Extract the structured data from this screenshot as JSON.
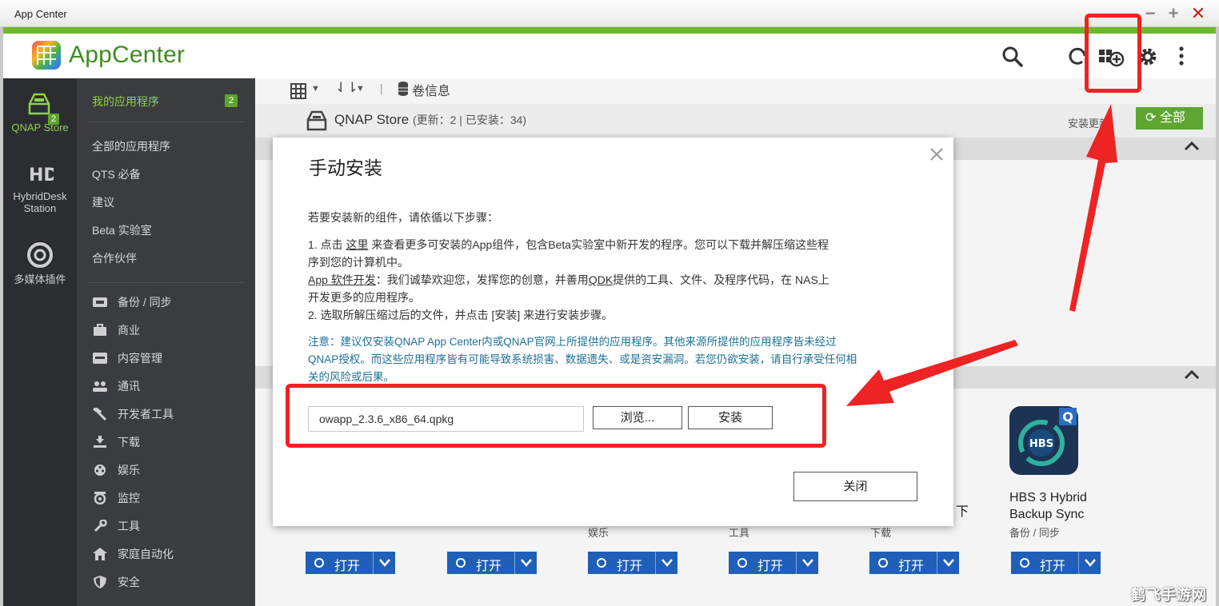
{
  "window": {
    "title": "App Center",
    "min": "−",
    "max": "+",
    "close": "✕"
  },
  "header": {
    "app_title": "AppCenter"
  },
  "rail": {
    "items": [
      {
        "label": "QNAP Store",
        "badge": "2"
      },
      {
        "label": "HybridDesk Station"
      },
      {
        "label": "多媒体插件"
      }
    ]
  },
  "categories": {
    "head": {
      "label": "我的应用程序",
      "badge": "2"
    },
    "items": [
      "全部的应用程序",
      "QTS 必备",
      "建议",
      "Beta 实验室",
      "合作伙伴"
    ],
    "sub": [
      "备份 / 同步",
      "商业",
      "内容管理",
      "通讯",
      "开发者工具",
      "下载",
      "娱乐",
      "监控",
      "工具",
      "家庭自动化",
      "安全"
    ]
  },
  "toolbar": {
    "sort_label": "⇃⇂",
    "divider": "|",
    "volume_label": "卷信息"
  },
  "store": {
    "title": "QNAP Store",
    "subtitle": "(更新：2 | 已安装：34)",
    "update_label": "安装更新：",
    "update_all": "全部"
  },
  "apps": [
    {
      "name": "HBS 3 Hybrid\nBackup Sync",
      "category": "备份 / 同步",
      "icon_letters": "HBS",
      "badge": "Q"
    }
  ],
  "visible_partial": {
    "cat_a": "娱乐",
    "cat_b": "工具",
    "cat_c": "下载",
    "edge_char": "下"
  },
  "open_button": {
    "label": "打开"
  },
  "modal": {
    "title": "手动安装",
    "intro": "若要安装新的组件，请依循以下步骤：",
    "step1_a": "1. 点击 ",
    "step1_link": "这里",
    "step1_b": " 来查看更多可安装的App组件，包含Beta实验室中新开发的程序。您可以下载并解压缩这些程",
    "step1_c": "序到您的计算机中。",
    "dev_link": "App 软件开发",
    "dev_a": "：我们诚挚欢迎您，发挥您的创意，并善用",
    "qdk_link": "QDK",
    "dev_b": "提供的工具、文件、及程序代码，在 NAS上",
    "dev_c": "开发更多的应用程序。",
    "step2": "2. 选取所解压缩过后的文件，并点击 [安装] 来进行安装步骤。",
    "note1": "注意：建议仅安装QNAP App Center内或QNAP官网上所提供的应用程序。其他来源所提供的应用程序皆未经过",
    "note2": "QNAP授权。而这些应用程序皆有可能导致系统损害、数据遗失、或是资安漏洞。若您仍欲安装，请自行承受任何相",
    "note3": "关的风险或后果。",
    "file_value": "owapp_2.3.6_x86_64.qpkg",
    "browse": "浏览...",
    "install": "安装",
    "close": "关闭"
  },
  "colors": {
    "accent_green": "#6fb827",
    "brand_green": "#3f8d20",
    "open_blue": "#1f5fb8",
    "annotation_red": "#ee2323",
    "note_blue": "#1e7196"
  },
  "watermark": "鹤飞手游网"
}
